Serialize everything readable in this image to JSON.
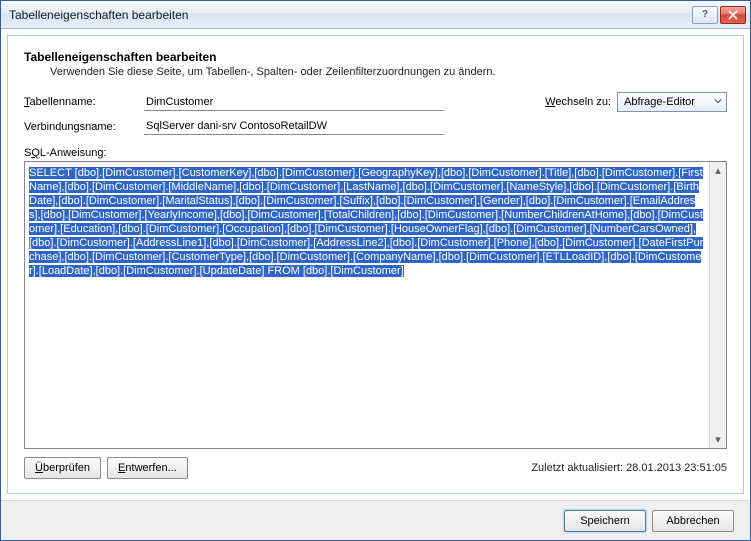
{
  "titlebar": {
    "title": "Tabelleneigenschaften bearbeiten"
  },
  "heading": "Tabelleneigenschaften bearbeiten",
  "subheading": "Verwenden Sie diese Seite, um Tabellen-, Spalten- oder Zeilenfilterzuordnungen zu ändern.",
  "labels": {
    "tablename": "Tabellenname:",
    "connname": "Verbindungsname:",
    "sql": "SQL-Anweisung:",
    "switch": "Wechseln zu:"
  },
  "values": {
    "tablename": "DimCustomer",
    "connname": "SqlServer dani-srv ContosoRetailDW",
    "switch_option": "Abfrage-Editor",
    "sql": "SELECT [dbo].[DimCustomer].[CustomerKey],[dbo].[DimCustomer].[GeographyKey],[dbo].[DimCustomer].[Title],[dbo].[DimCustomer].[FirstName],[dbo].[DimCustomer].[MiddleName],[dbo].[DimCustomer].[LastName],[dbo].[DimCustomer].[NameStyle],[dbo].[DimCustomer].[BirthDate],[dbo].[DimCustomer].[MaritalStatus],[dbo].[DimCustomer].[Suffix],[dbo].[DimCustomer].[Gender],[dbo].[DimCustomer].[EmailAddress],[dbo].[DimCustomer].[YearlyIncome],[dbo].[DimCustomer].[TotalChildren],[dbo].[DimCustomer].[NumberChildrenAtHome],[dbo].[DimCustomer].[Education],[dbo].[DimCustomer].[Occupation],[dbo].[DimCustomer].[HouseOwnerFlag],[dbo].[DimCustomer].[NumberCarsOwned],[dbo].[DimCustomer].[AddressLine1],[dbo].[DimCustomer].[AddressLine2],[dbo].[DimCustomer].[Phone],[dbo].[DimCustomer].[DateFirstPurchase],[dbo].[DimCustomer].[CustomerType],[dbo].[DimCustomer].[CompanyName],[dbo].[DimCustomer].[ETLLoadID],[dbo].[DimCustomer].[LoadDate],[dbo].[DimCustomer].[UpdateDate]                   FROM [dbo].[DimCustomer]"
  },
  "buttons": {
    "validate_pre": "Ü",
    "validate_rest": "berprüfen",
    "design_pre": "E",
    "design_rest": "ntwerfen...",
    "save": "Speichern",
    "cancel": "Abbrechen"
  },
  "status": "Zuletzt aktualisiert: 28.01.2013 23:51:05"
}
